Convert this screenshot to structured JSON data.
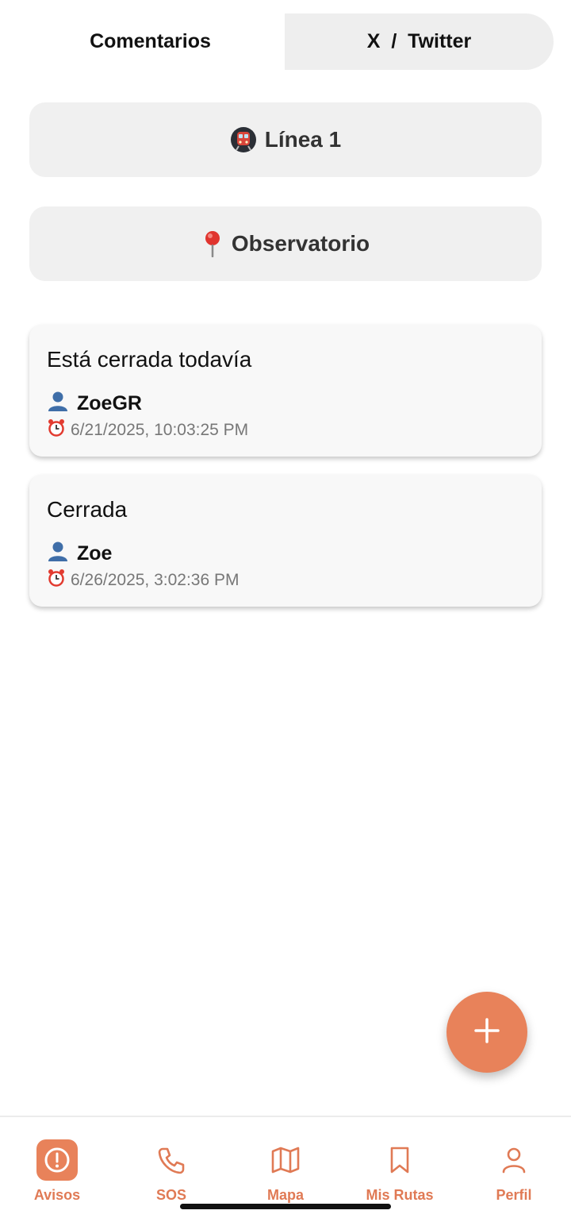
{
  "tabs": {
    "comments": "Comentarios",
    "twitter": "X  /  Twitter"
  },
  "filters": {
    "line": "Línea 1",
    "station": "Observatorio",
    "line_icon": "metro-icon",
    "station_icon": "pin-icon"
  },
  "comments": [
    {
      "message": "Está cerrada todavía",
      "user": "ZoeGR",
      "timestamp": "6/21/2025, 10:03:25 PM"
    },
    {
      "message": "Cerrada",
      "user": "Zoe",
      "timestamp": "6/26/2025, 3:02:36 PM"
    }
  ],
  "fab": {
    "icon": "plus-icon"
  },
  "nav": {
    "items": [
      {
        "label": "Avisos",
        "icon": "alert-icon",
        "active": true
      },
      {
        "label": "SOS",
        "icon": "phone-icon",
        "active": false
      },
      {
        "label": "Mapa",
        "icon": "map-icon",
        "active": false
      },
      {
        "label": "Mis Rutas",
        "icon": "bookmark-icon",
        "active": false
      },
      {
        "label": "Perfil",
        "icon": "user-icon",
        "active": false
      }
    ]
  },
  "colors": {
    "accent": "#e8825a",
    "accent_text": "#e07a55",
    "pill_bg": "#f0f0f0",
    "card_bg": "#f8f8f8"
  }
}
